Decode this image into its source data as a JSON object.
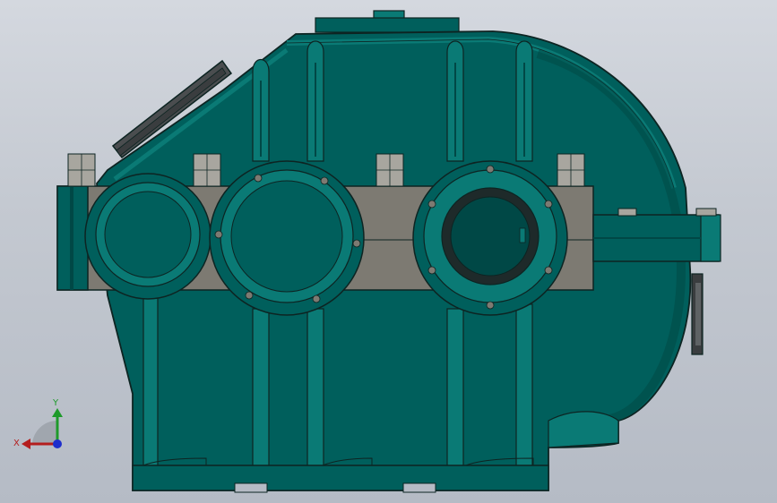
{
  "viewport": {
    "model": "gearbox-housing",
    "colors": {
      "housing": "#005f5c",
      "housing_light": "#0a7a75",
      "housing_dark": "#004846",
      "edge": "#0d2422",
      "flange": "#7d7a72",
      "flange_dark": "#5d5a54",
      "bolt": "#a8a69f",
      "inspection_cover": "#4a4d4f"
    }
  },
  "triad": {
    "x_label": "X",
    "y_label": "Y",
    "x_color": "#b41e1e",
    "y_color": "#1e9a2a",
    "z_color": "#1e2ecc"
  }
}
